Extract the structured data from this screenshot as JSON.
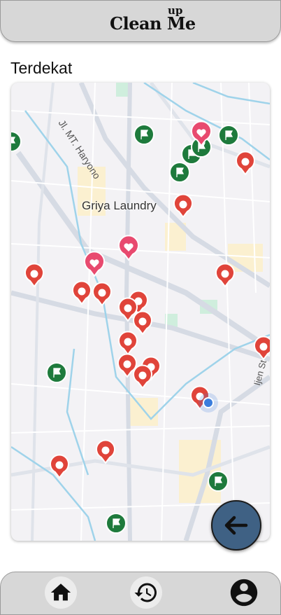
{
  "app": {
    "title": "Clean Me",
    "title_superscript": "up"
  },
  "section": {
    "title": "Terdekat"
  },
  "map": {
    "place_label": "Griya Laundry",
    "road_labels": [
      "Jl. MT. Haryono",
      "Ijen St"
    ],
    "pin_colors": {
      "laundry": "#e0443a",
      "favorite": "#e84a6f",
      "flag": "#1e7a3c",
      "user_location": "#3b7ddd"
    }
  },
  "fab": {
    "icon": "arrow-left-icon"
  },
  "bottom_nav": {
    "items": [
      {
        "icon": "home-icon"
      },
      {
        "icon": "history-icon"
      },
      {
        "icon": "account-icon"
      }
    ]
  }
}
